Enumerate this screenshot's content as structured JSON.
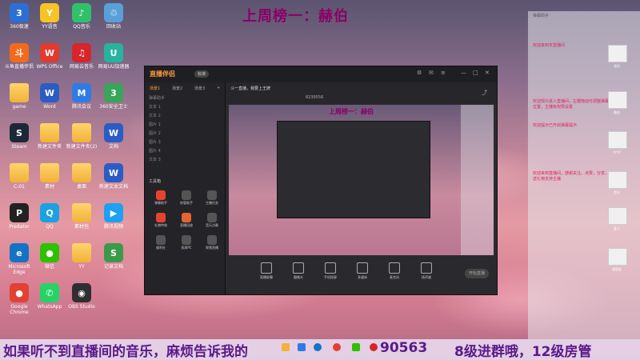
{
  "overlay": {
    "top_title": "上周榜一：赫伯",
    "bottom_left": "如果听不到直播间的音乐，麻烦告诉我的",
    "bottom_number": "90563",
    "bottom_right": "8级进群哦，12级房管"
  },
  "desktop_icons": [
    {
      "label": "360极速",
      "color": "#2c6fd6",
      "glyph": "3"
    },
    {
      "label": "YY语音",
      "color": "#f7c326",
      "glyph": "Y"
    },
    {
      "label": "QQ音乐",
      "color": "#2fc26a",
      "glyph": "♪"
    },
    {
      "label": "回收站",
      "color": "#5aa0d8",
      "glyph": "♲"
    },
    {
      "label": "斗鱼直播伴侣",
      "color": "#f26a1b",
      "glyph": "斗"
    },
    {
      "label": "WPS Office",
      "color": "#e23a2c",
      "glyph": "W"
    },
    {
      "label": "网易云音乐",
      "color": "#d7262b",
      "glyph": "♫"
    },
    {
      "label": "网易UU加速器",
      "color": "#27b3a0",
      "glyph": "U"
    },
    {
      "label": "game",
      "color": "#f0b23a",
      "glyph": ""
    },
    {
      "label": "Word",
      "color": "#2b5cc4",
      "glyph": "W"
    },
    {
      "label": "腾讯会议",
      "color": "#2f7be6",
      "glyph": "M"
    },
    {
      "label": "360安全卫士",
      "color": "#3aa45a",
      "glyph": "3"
    },
    {
      "label": "Steam",
      "color": "#1b2838",
      "glyph": "S"
    },
    {
      "label": "新建文件夹",
      "color": "#f0b23a",
      "glyph": ""
    },
    {
      "label": "新建文件夹(2)",
      "color": "#f0b23a",
      "glyph": ""
    },
    {
      "label": "文档",
      "color": "#2b5cc4",
      "glyph": "W"
    },
    {
      "label": "C-01",
      "color": "#f0b23a",
      "glyph": ""
    },
    {
      "label": "素材",
      "color": "#f0b23a",
      "glyph": ""
    },
    {
      "label": "桌面",
      "color": "#f0b23a",
      "glyph": ""
    },
    {
      "label": "新建文本文档",
      "color": "#2b5cc4",
      "glyph": "W"
    },
    {
      "label": "Predator",
      "color": "#222",
      "glyph": "P"
    },
    {
      "label": "QQ",
      "color": "#1aa1e2",
      "glyph": "Q"
    },
    {
      "label": "素材包",
      "color": "#f0b23a",
      "glyph": ""
    },
    {
      "label": "腾讯视频",
      "color": "#1da1f2",
      "glyph": "▶"
    },
    {
      "label": "Microsoft Edge",
      "color": "#1573c5",
      "glyph": "e"
    },
    {
      "label": "微信",
      "color": "#2dc100",
      "glyph": "●"
    },
    {
      "label": "YY",
      "color": "#f0b23a",
      "glyph": ""
    },
    {
      "label": "记录文档",
      "color": "#3a9a4a",
      "glyph": "S"
    },
    {
      "label": "Google Chrome",
      "color": "#e34133",
      "glyph": "●"
    },
    {
      "label": "WhatsApp",
      "color": "#25d366",
      "glyph": "✆"
    },
    {
      "label": "OBS Studio",
      "color": "#302e31",
      "glyph": "◉"
    }
  ],
  "app": {
    "logo": "直播伴侣",
    "badge": "标准",
    "side_tabs": [
      "场景1",
      "场景2",
      "场景3"
    ],
    "side_items": [
      "弹幕助手",
      "文本 1",
      "文本 2",
      "图片 1",
      "图片 2",
      "图片 3",
      "图片 4",
      "文本 3"
    ],
    "section_label": "工具箱",
    "tools": [
      "弹幕助手",
      "房管助手",
      "主播任务",
      "礼物特效",
      "直播回放",
      "音乐点歌",
      "福利社",
      "投屏PC",
      "视频直播"
    ],
    "scene_info": "斗一直播，我要上王牌",
    "room_id": "8239556",
    "preview_caption": "上周榜一：赫伯",
    "toolbar": [
      "直播屏幕",
      "摄像头",
      "手机投屏",
      "多媒体",
      "麦克风",
      "扬声器"
    ],
    "start_btn": "开始直播"
  },
  "chat": {
    "header": "弹幕助手",
    "lines": [
      {
        "text": "欢迎来到本直播间"
      },
      {
        "text": "欢迎观众进入直播间，左键拖动可调整弹幕位置，主播有权限设置"
      },
      {
        "text": "欢迎提示已开启弹幕提示"
      },
      {
        "text": "欢迎来到直播间，感谢关注，点赞，分享，送礼物支持主播"
      }
    ],
    "avatar_names": [
      "亚伯",
      "赛伯",
      "YYYY",
      "音乐",
      "某人",
      "我是谁"
    ]
  },
  "colors": {
    "accent": "#ff9a3c",
    "title": "#8b0066",
    "banner_text": "#5a1a8a",
    "chat_text": "#e0205a"
  }
}
